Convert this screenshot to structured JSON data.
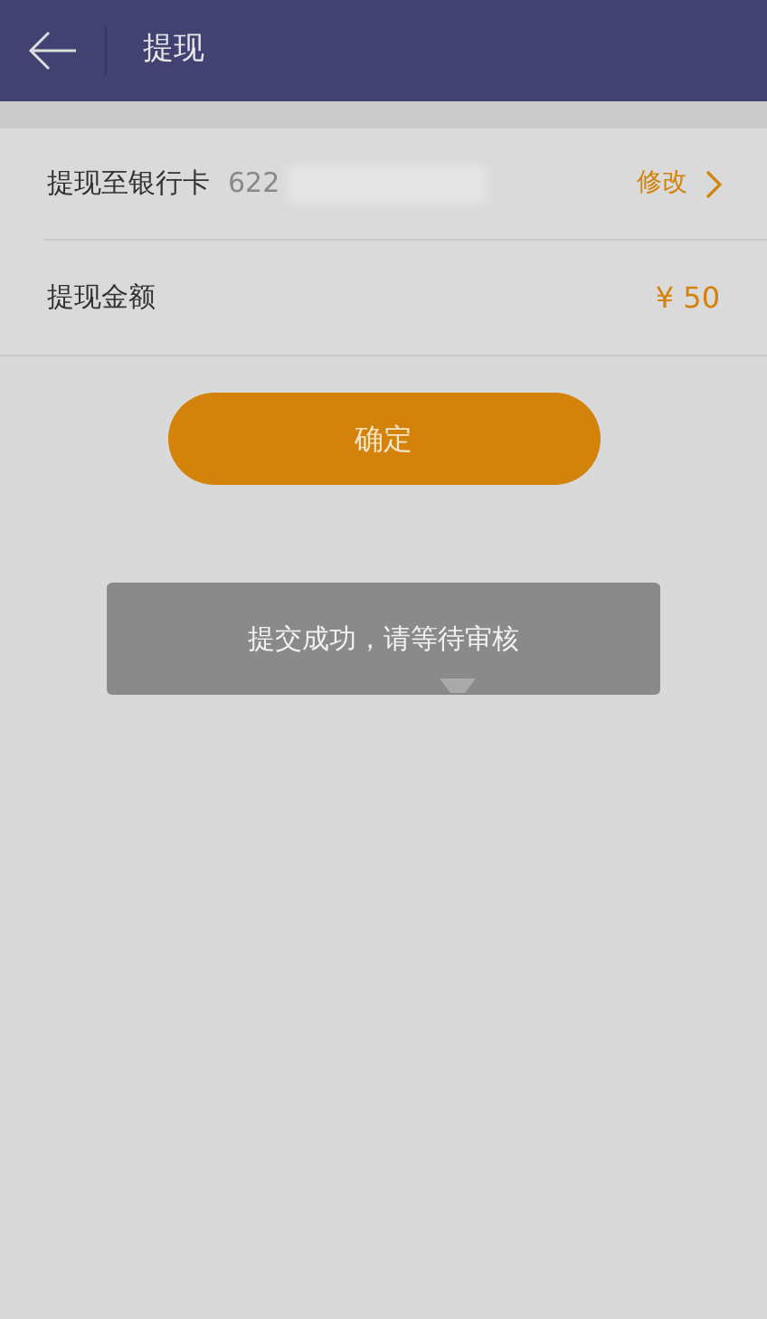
{
  "header": {
    "title": "提现"
  },
  "rows": [
    {
      "kind": "card",
      "label": "提现至银行卡",
      "value": "622",
      "action": "修改"
    },
    {
      "kind": "amount",
      "label": "提现金额",
      "value": "¥ 50"
    }
  ],
  "confirm_button": "确定",
  "toast": {
    "message": "提交成功，请等待审核"
  }
}
